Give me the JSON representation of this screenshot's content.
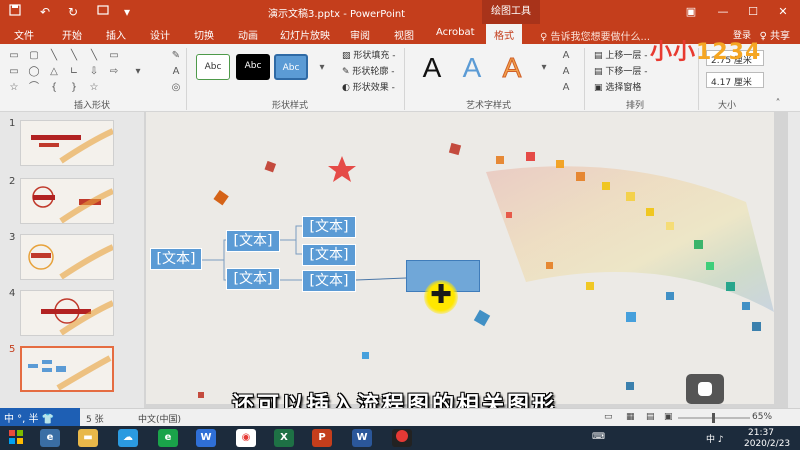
{
  "titlebar": {
    "title": "演示文稿3.pptx - PowerPoint",
    "context_tab": "绘图工具",
    "buttons": {
      "minimize": "—",
      "maximize": "☐",
      "close": "✕",
      "options": "▣"
    }
  },
  "tabs": [
    {
      "label": "文件"
    },
    {
      "label": "开始"
    },
    {
      "label": "插入"
    },
    {
      "label": "设计"
    },
    {
      "label": "切换"
    },
    {
      "label": "动画"
    },
    {
      "label": "幻灯片放映"
    },
    {
      "label": "审阅"
    },
    {
      "label": "视图"
    },
    {
      "label": "Acrobat"
    },
    {
      "label": "格式"
    }
  ],
  "tellme": "♀ 告诉我您想要做什么...",
  "login": "登录",
  "share": "♀ 共享",
  "ribbon": {
    "groups": {
      "insert_shapes": "插入形状",
      "shape_styles": "形状样式",
      "wordart_styles": "艺术字样式",
      "arrange": "排列",
      "size": "大小"
    },
    "style_presets": [
      "Abc",
      "Abc",
      "Abc"
    ],
    "shape_format": {
      "fill": "形状填充 -",
      "outline": "形状轮廓 -",
      "effects": "形状效果 -"
    },
    "wordart": [
      "A",
      "A",
      "A"
    ],
    "arrange": {
      "forward": "上移一层 -",
      "backward": "下移一层 -",
      "selection": "选择窗格"
    },
    "size": {
      "height": "2.75 厘米",
      "width": "4.17 厘米"
    }
  },
  "logo": {
    "part1": "小小",
    "part2": "1234"
  },
  "thumbnails": [
    {
      "num": "1"
    },
    {
      "num": "2"
    },
    {
      "num": "3"
    },
    {
      "num": "4"
    },
    {
      "num": "5"
    }
  ],
  "slide": {
    "smartart": {
      "root": "[文本]",
      "level2": [
        "[文本]",
        "[文本]"
      ],
      "level3": [
        "[文本]",
        "[文本]",
        "[文本]"
      ]
    }
  },
  "subtitle": "还可以插入流程图的相关图形",
  "statusbar": {
    "slide_count": "5 张",
    "language": "中文(中国)",
    "ime": "中 °, 半 👕",
    "zoom": "65%"
  },
  "taskbar": {
    "apps": [
      "X",
      "P",
      "W"
    ],
    "time": "21:37",
    "date": "2020/2/23",
    "tray": "中 ♪"
  },
  "colors": {
    "accent": "#c43e1c",
    "smartart_blue": "#5b9bd5",
    "taskbar": "#1c2b3c"
  }
}
